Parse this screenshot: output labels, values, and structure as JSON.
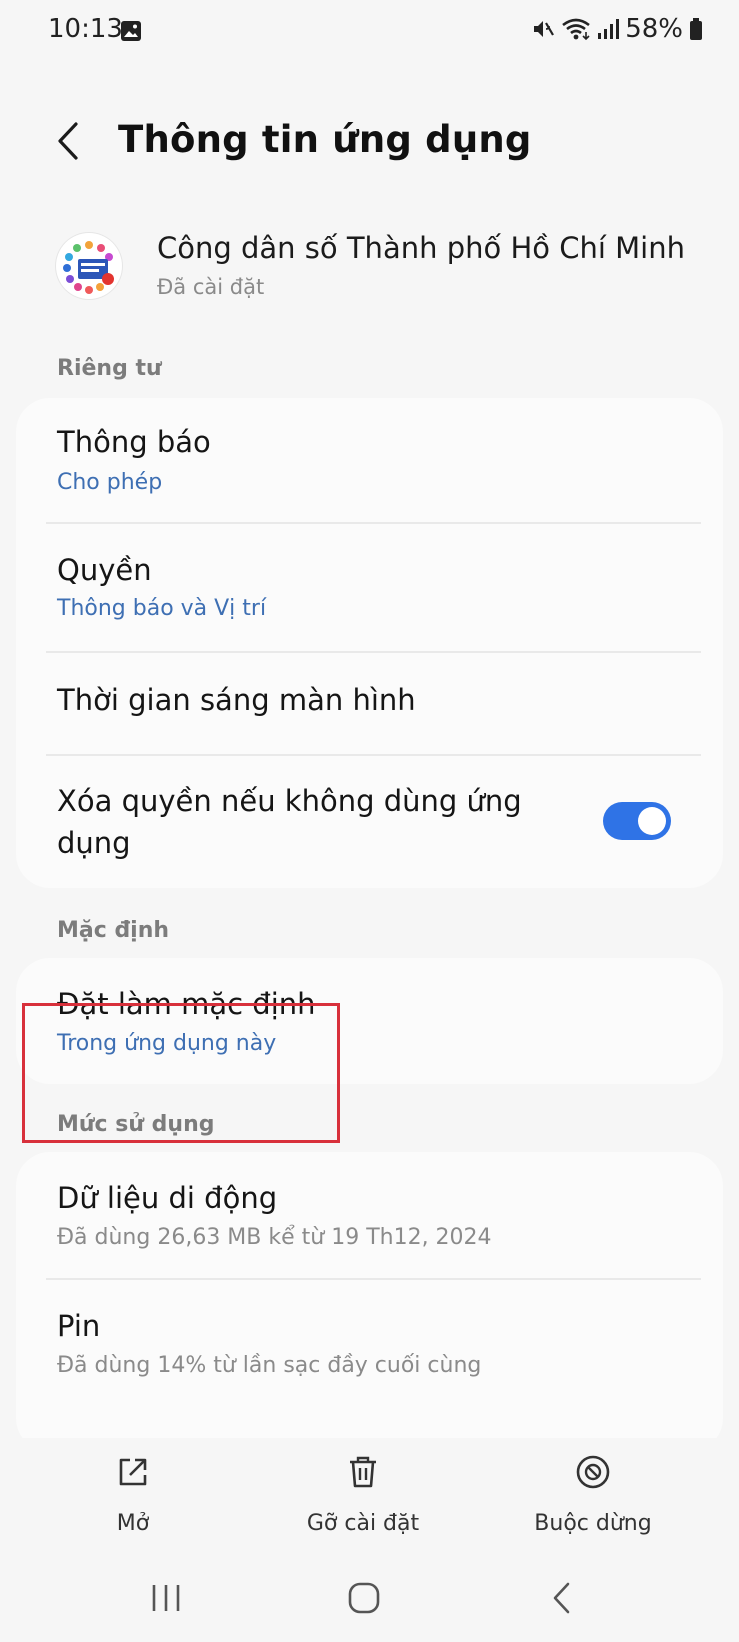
{
  "status_bar": {
    "time": "10:13",
    "battery": "58%",
    "icons": [
      "gallery-icon",
      "mute-icon",
      "wifi-icon",
      "signal-icon",
      "battery-icon"
    ]
  },
  "header": {
    "title": "Thông tin ứng dụng",
    "back_icon": "back-chevron-icon"
  },
  "app": {
    "name": "Công dân số Thành phố Hồ Chí Minh",
    "status": "Đã cài đặt",
    "icon": "app-logo-icon"
  },
  "sections": {
    "privacy": {
      "header": "Riêng tư",
      "items": [
        {
          "title": "Thông báo",
          "subtitle": "Cho phép"
        },
        {
          "title": "Quyền",
          "subtitle": "Thông báo và Vị trí"
        },
        {
          "title": "Thời gian sáng màn hình"
        },
        {
          "title": "Xóa quyền nếu không dùng ứng dụng",
          "toggle_on": true
        }
      ]
    },
    "defaults": {
      "header": "Mặc định",
      "items": [
        {
          "title": "Đặt làm mặc định",
          "subtitle": "Trong ứng dụng này"
        }
      ]
    },
    "usage": {
      "header": "Mức sử dụng",
      "items": [
        {
          "title": "Dữ liệu di động",
          "subtitle": "Đã dùng 26,63 MB kể từ 19 Th12, 2024"
        },
        {
          "title": "Pin",
          "subtitle": "Đã dùng 14% từ lần sạc đầy cuối cùng"
        }
      ]
    }
  },
  "actions": [
    {
      "label": "Mở",
      "icon": "open-external-icon"
    },
    {
      "label": "Gỡ cài đặt",
      "icon": "trash-icon"
    },
    {
      "label": "Buộc dừng",
      "icon": "force-stop-icon"
    }
  ],
  "nav": [
    "recents-icon",
    "home-icon",
    "back-icon"
  ],
  "colors": {
    "accent_blue": "#3e6fb3",
    "toggle_blue": "#2f73e6",
    "highlight_red": "#d8303b",
    "background": "#f6f6f6",
    "card": "#fbfbfb"
  }
}
